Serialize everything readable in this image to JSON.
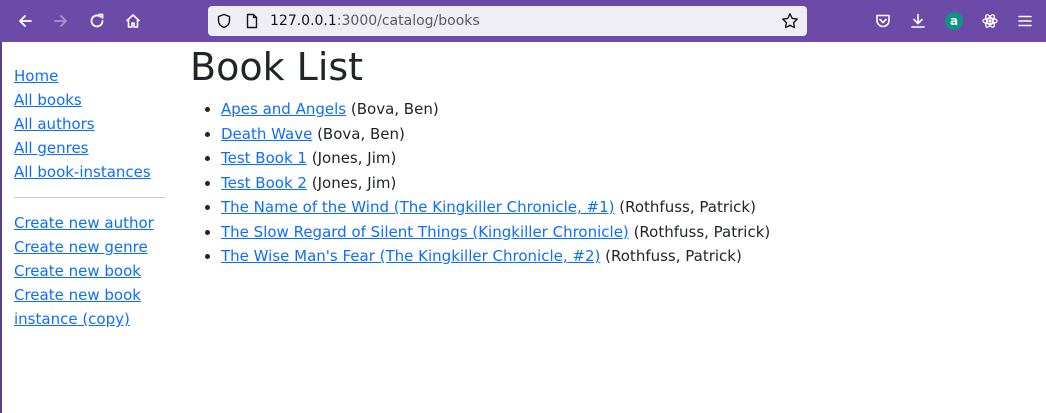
{
  "browser": {
    "url_host": "127.0.0.1",
    "url_path": ":3000/catalog/books",
    "icons": [
      "back-icon",
      "forward-icon",
      "reload-icon",
      "home-icon",
      "shield-icon",
      "page-icon",
      "star-icon",
      "pocket-icon",
      "download-icon",
      "account-icon",
      "extension-icon",
      "menu-icon"
    ],
    "account_letter": "a",
    "colors": {
      "toolbar": "#6c4ba8",
      "urlbar": "#efeef6",
      "account_badge": "#0d9488"
    }
  },
  "sidebar": {
    "nav": [
      {
        "label": "Home"
      },
      {
        "label": "All books"
      },
      {
        "label": "All authors"
      },
      {
        "label": "All genres"
      },
      {
        "label": "All book-instances"
      }
    ],
    "create": [
      {
        "label": "Create new author"
      },
      {
        "label": "Create new genre"
      },
      {
        "label": "Create new book"
      },
      {
        "label": "Create new book instance (copy)"
      }
    ]
  },
  "main": {
    "title": "Book List",
    "books": [
      {
        "title": "Apes and Angels",
        "author": "(Bova, Ben)"
      },
      {
        "title": "Death Wave",
        "author": "(Bova, Ben)"
      },
      {
        "title": "Test Book 1",
        "author": "(Jones, Jim)"
      },
      {
        "title": "Test Book 2",
        "author": "(Jones, Jim)"
      },
      {
        "title": "The Name of the Wind (The Kingkiller Chronicle, #1)",
        "author": "(Rothfuss, Patrick)"
      },
      {
        "title": "The Slow Regard of Silent Things (Kingkiller Chronicle)",
        "author": "(Rothfuss, Patrick)"
      },
      {
        "title": "The Wise Man's Fear (The Kingkiller Chronicle, #2)",
        "author": "(Rothfuss, Patrick)"
      }
    ]
  },
  "colors": {
    "link": "#0d6efd",
    "text": "#212529"
  }
}
